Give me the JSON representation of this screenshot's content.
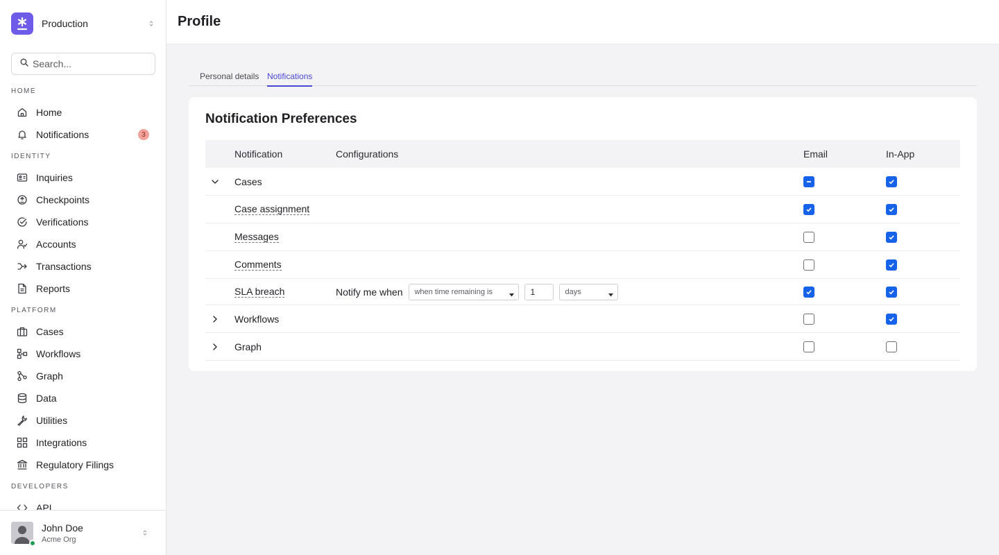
{
  "org": {
    "name": "Production"
  },
  "search": {
    "placeholder": "Search..."
  },
  "sidebar": {
    "sections": [
      {
        "title": "HOME",
        "items": [
          {
            "label": "Home",
            "icon": "home-icon"
          },
          {
            "label": "Notifications",
            "icon": "bell-icon",
            "badge": "3"
          }
        ]
      },
      {
        "title": "IDENTITY",
        "items": [
          {
            "label": "Inquiries",
            "icon": "id-card-icon"
          },
          {
            "label": "Checkpoints",
            "icon": "checkpoint-icon"
          },
          {
            "label": "Verifications",
            "icon": "check-circle-icon"
          },
          {
            "label": "Accounts",
            "icon": "user-check-icon"
          },
          {
            "label": "Transactions",
            "icon": "transaction-icon"
          },
          {
            "label": "Reports",
            "icon": "report-icon"
          }
        ]
      },
      {
        "title": "PLATFORM",
        "items": [
          {
            "label": "Cases",
            "icon": "briefcase-icon"
          },
          {
            "label": "Workflows",
            "icon": "workflow-icon"
          },
          {
            "label": "Graph",
            "icon": "graph-icon"
          },
          {
            "label": "Data",
            "icon": "database-icon"
          },
          {
            "label": "Utilities",
            "icon": "wrench-icon"
          },
          {
            "label": "Integrations",
            "icon": "grid-icon"
          },
          {
            "label": "Regulatory Filings",
            "icon": "bank-icon"
          }
        ]
      },
      {
        "title": "DEVELOPERS",
        "items": [
          {
            "label": "API",
            "icon": "code-icon"
          }
        ]
      }
    ]
  },
  "user": {
    "name": "John Doe",
    "org": "Acme Org"
  },
  "page": {
    "title": "Profile"
  },
  "tabs": [
    {
      "label": "Personal details",
      "active": false
    },
    {
      "label": "Notifications",
      "active": true
    }
  ],
  "card": {
    "title": "Notification Preferences"
  },
  "table": {
    "headers": {
      "notification": "Notification",
      "configurations": "Configurations",
      "email": "Email",
      "inapp": "In-App"
    },
    "rows": [
      {
        "name": "Cases",
        "expander": "expanded",
        "email": "indeterminate",
        "inapp": "checked"
      },
      {
        "name": "Case assignment",
        "child": true,
        "email": "checked",
        "inapp": "checked"
      },
      {
        "name": "Messages",
        "child": true,
        "email": "unchecked",
        "inapp": "checked"
      },
      {
        "name": "Comments",
        "child": true,
        "email": "unchecked",
        "inapp": "checked"
      },
      {
        "name": "SLA breach",
        "child": true,
        "email": "checked",
        "inapp": "checked",
        "config": {
          "label": "Notify me when",
          "condition": "when time remaining is",
          "value": "1",
          "unit": "days"
        }
      },
      {
        "name": "Workflows",
        "expander": "collapsed",
        "email": "unchecked",
        "inapp": "checked"
      },
      {
        "name": "Graph",
        "expander": "collapsed",
        "email": "unchecked",
        "inapp": "unchecked"
      }
    ]
  },
  "colors": {
    "accent": "#4a47d8",
    "checkbox": "#1662e8",
    "logo": "#6c5ce7",
    "badge": "#f2a29a",
    "online": "#1f9d55"
  }
}
